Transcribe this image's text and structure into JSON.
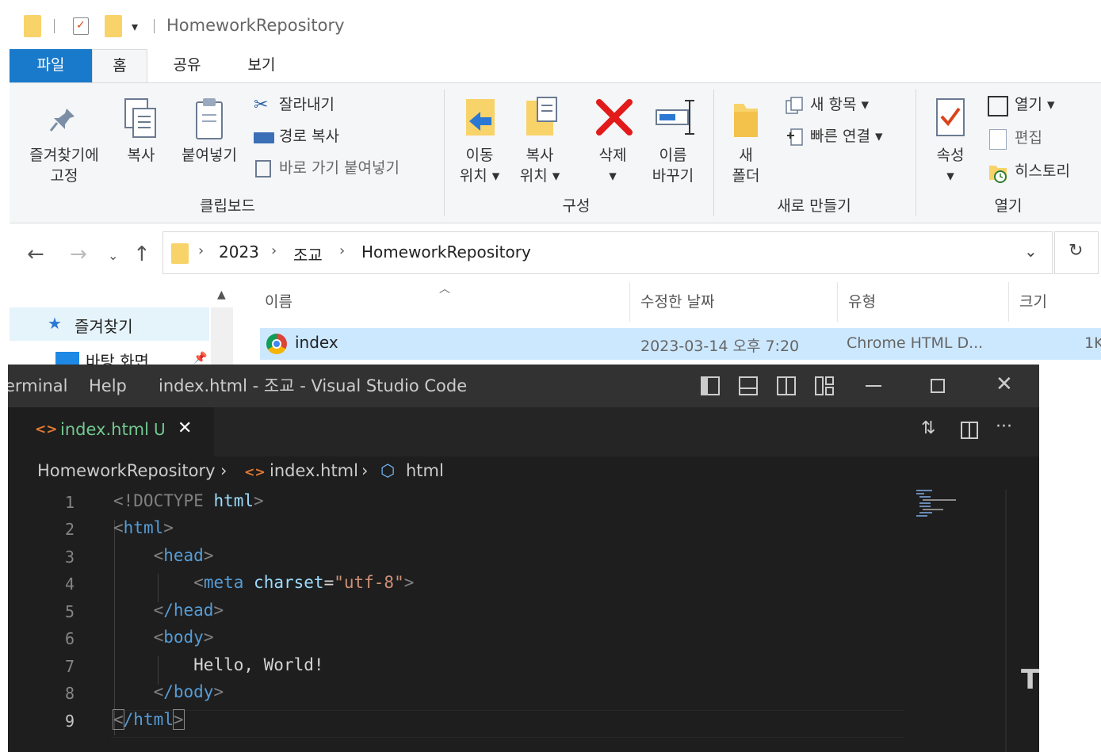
{
  "explorer": {
    "title": "HomeworkRepository",
    "tabs": [
      "파일",
      "홈",
      "공유",
      "보기"
    ],
    "ribbon": {
      "pin_label_1": "즐겨찾기에",
      "pin_label_2": "고정",
      "copy_label": "복사",
      "paste_label": "붙여넣기",
      "cut_label": "잘라내기",
      "copy_path_label": "경로 복사",
      "paste_shortcut_label": "바로 가기 붙여넣기",
      "clipboard_group": "클립보드",
      "move_to_1": "이동",
      "move_to_2": "위치 ▾",
      "copy_to_1": "복사",
      "copy_to_2": "위치 ▾",
      "delete_1": "삭제",
      "delete_2": "▾",
      "rename_1": "이름",
      "rename_2": "바꾸기",
      "organize_group": "구성",
      "new_folder_1": "새",
      "new_folder_2": "폴더",
      "new_item": "새 항목 ▾",
      "easy_access": "빠른 연결 ▾",
      "new_group": "새로 만들기",
      "properties_1": "속성",
      "properties_2": "▾",
      "open": "열기 ▾",
      "edit": "편집",
      "history": "히스토리",
      "open_group": "열기"
    },
    "address": {
      "segments": [
        "2023",
        "조교",
        "HomeworkRepository"
      ]
    },
    "nav": {
      "favorites": "즐겨찾기",
      "desktop": "바탕 화면"
    },
    "columns": [
      "이름",
      "수정한 날짜",
      "유형",
      "크기"
    ],
    "files": [
      {
        "name": "index",
        "date": "2023-03-14 오후 7:20",
        "type": "Chrome HTML D...",
        "size": "1K"
      }
    ]
  },
  "vscode": {
    "menu_terminal": "erminal",
    "menu_help": "Help",
    "window_title": "index.html - 조교 - Visual Studio Code",
    "tab_label": "index.html",
    "tab_status": "U",
    "breadcrumbs": [
      "HomeworkRepository",
      "index.html",
      "html"
    ],
    "line_numbers": [
      "1",
      "2",
      "3",
      "4",
      "5",
      "6",
      "7",
      "8",
      "9"
    ],
    "code": {
      "l1_doctype": "<!DOCTYPE",
      "l1_html": "html",
      "l2_tag": "html",
      "l3_tag": "head",
      "l4_tag": "meta",
      "l4_attr": "charset",
      "l4_val": "\"utf-8\"",
      "l5_tag": "/head",
      "l6_tag": "body",
      "l7_text": "Hello, World!",
      "l8_tag": "/body",
      "l9_tag": "/html"
    }
  }
}
